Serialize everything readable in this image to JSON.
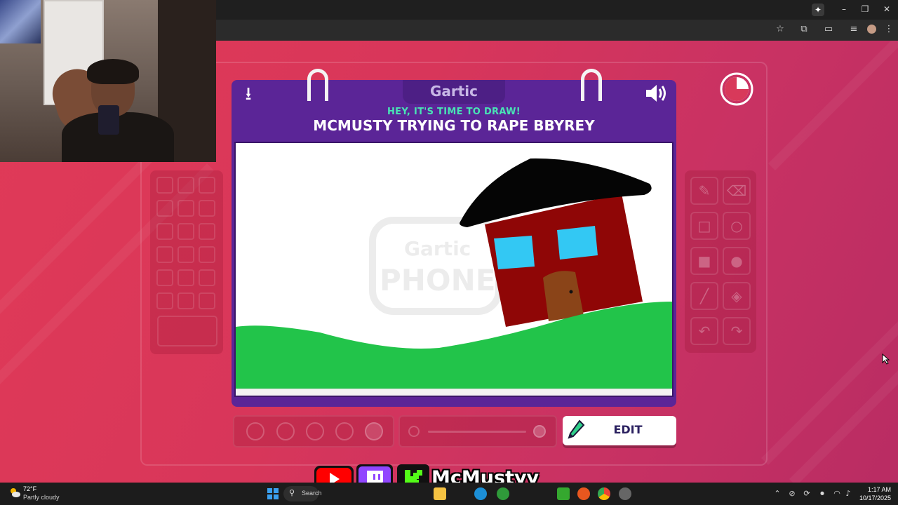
{
  "browser": {
    "window_controls": [
      "–",
      "❐",
      "✕"
    ],
    "ai_button_icon": "sparkle-icon"
  },
  "game": {
    "logo": "Gartic",
    "subtitle": "HEY, IT'S TIME TO DRAW!",
    "prompt": "MCMUSTY TRYING TO RAPE BBYREY",
    "watermark": "Gartic PHONE",
    "edit_label": "EDIT",
    "timer_progress": 0.25,
    "colors": {
      "card": "#5b2597",
      "subtitle": "#49e3b5",
      "background": "#d8395a",
      "grass": "#22c44a",
      "house": "#8f0606",
      "roof": "#050505",
      "window": "#33c8f3",
      "door": "#8a4418"
    }
  },
  "overlay": {
    "channel_name": "McMustyy",
    "platforms": [
      "youtube-icon",
      "twitch-icon",
      "kick-icon"
    ]
  },
  "taskbar": {
    "temperature": "72°F",
    "weather": "Partly cloudy",
    "search_placeholder": "Search",
    "time": "1:17 AM",
    "date": "10/17/2025"
  }
}
